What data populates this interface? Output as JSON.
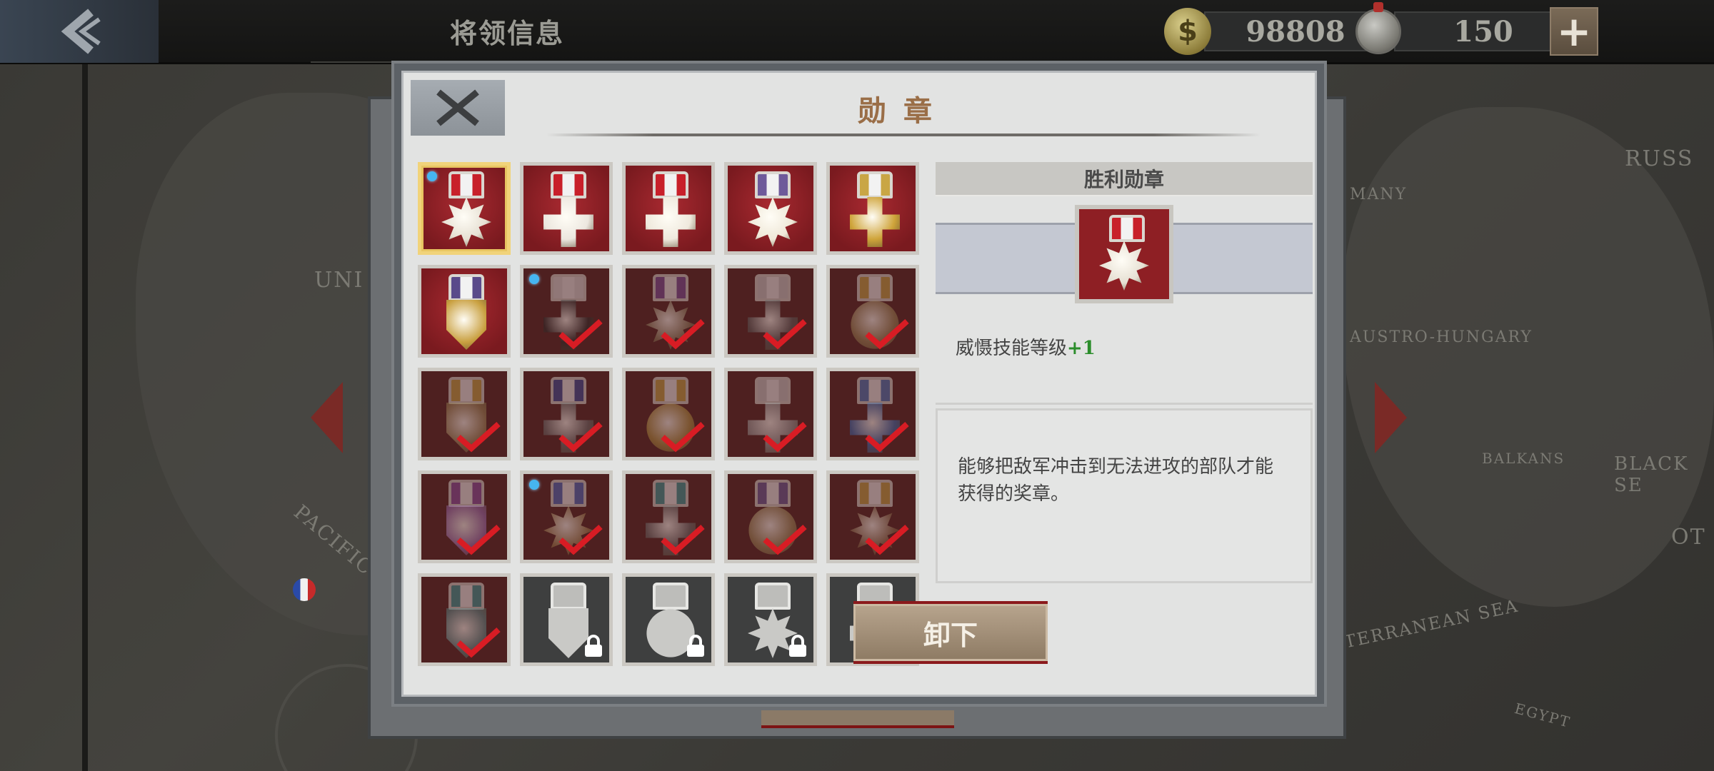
{
  "topbar": {
    "back_icon": "back-arrow-icon",
    "title": "将领信息",
    "gold_amount": "98808",
    "gold_symbol": "$",
    "medal_amount": "150",
    "plus_symbol": "+"
  },
  "map_labels": {
    "uni": "UNI",
    "russ": "RUSS",
    "many": "MANY",
    "austro": "AUSTRO-HUNGARY",
    "balkans": "BALKANS",
    "black_sea": "BLACK SE",
    "ot": "OT",
    "med": "TERRANEAN SEA",
    "egypt": "EGYPT",
    "pacific": "PACIFIC"
  },
  "modal": {
    "title": "勋章",
    "close_icon": "close-x-icon"
  },
  "medals": [
    {
      "state": "owned",
      "shape": "sun",
      "ribbon": "#c8202a",
      "metal": "#e6e0d3",
      "selected": true,
      "new": true
    },
    {
      "state": "owned",
      "shape": "cross",
      "ribbon": "#c8202a",
      "metal": "#ece7df",
      "selected": false,
      "new": false
    },
    {
      "state": "owned",
      "shape": "cross",
      "ribbon": "#c8202a",
      "metal": "#efe9dd",
      "selected": false,
      "new": false
    },
    {
      "state": "owned",
      "shape": "sun",
      "ribbon": "#6e5a9a",
      "metal": "#efe8d8",
      "selected": false,
      "new": false
    },
    {
      "state": "owned",
      "shape": "cross",
      "ribbon": "#c9a645",
      "metal": "#cfa43a",
      "selected": false,
      "new": false
    },
    {
      "state": "owned",
      "shape": "shield",
      "ribbon": "#5a4a8a",
      "metal": "#c9a040",
      "selected": false,
      "new": false
    },
    {
      "state": "done",
      "shape": "cross",
      "ribbon": "#e0e0e0",
      "metal": "#2a2a2a",
      "selected": false,
      "new": true
    },
    {
      "state": "done",
      "shape": "sun",
      "ribbon": "#7a4a9a",
      "metal": "#8b7a5a",
      "selected": false,
      "new": false
    },
    {
      "state": "done",
      "shape": "cross",
      "ribbon": "#d0d0d0",
      "metal": "#5a5a5a",
      "selected": false,
      "new": false
    },
    {
      "state": "done",
      "shape": "medal",
      "ribbon": "#c9a645",
      "metal": "#9c8455",
      "selected": false,
      "new": false
    },
    {
      "state": "done",
      "shape": "shield",
      "ribbon": "#c9a645",
      "metal": "#9c8455",
      "selected": false,
      "new": false
    },
    {
      "state": "done",
      "shape": "cross",
      "ribbon": "#3a4a9a",
      "metal": "#6a6a6a",
      "selected": false,
      "new": false
    },
    {
      "state": "done",
      "shape": "round",
      "ribbon": "#c9a645",
      "metal": "#b09040",
      "selected": false,
      "new": false
    },
    {
      "state": "done",
      "shape": "cross",
      "ribbon": "#d0d0d0",
      "metal": "#9a9a9a",
      "selected": false,
      "new": false
    },
    {
      "state": "done",
      "shape": "cross",
      "ribbon": "#4a7ac0",
      "metal": "#3a6ab0",
      "selected": false,
      "new": false
    },
    {
      "state": "done",
      "shape": "shield",
      "ribbon": "#8a4aa0",
      "metal": "#9a6ab0",
      "selected": false,
      "new": false
    },
    {
      "state": "done",
      "shape": "sun",
      "ribbon": "#4a6ac0",
      "metal": "#a08050",
      "selected": false,
      "new": true
    },
    {
      "state": "done",
      "shape": "cross",
      "ribbon": "#3a9a9a",
      "metal": "#6a6a6a",
      "selected": false,
      "new": false
    },
    {
      "state": "done",
      "shape": "medal",
      "ribbon": "#6a5a9a",
      "metal": "#a08a5a",
      "selected": false,
      "new": false
    },
    {
      "state": "done",
      "shape": "sun",
      "ribbon": "#c9a645",
      "metal": "#8a6a4a",
      "selected": false,
      "new": false
    },
    {
      "state": "done",
      "shape": "shield",
      "ribbon": "#3a9a9a",
      "metal": "#5a8a8a",
      "selected": false,
      "new": false
    },
    {
      "state": "locked",
      "shape": "shield",
      "ribbon": "#c0c0c0",
      "metal": "#c0c0c0",
      "selected": false,
      "new": false
    },
    {
      "state": "locked",
      "shape": "medal",
      "ribbon": "#c0c0c0",
      "metal": "#c0c0c0",
      "selected": false,
      "new": false
    },
    {
      "state": "locked",
      "shape": "sun",
      "ribbon": "#c0c0c0",
      "metal": "#c0c0c0",
      "selected": false,
      "new": false
    },
    {
      "state": "locked",
      "shape": "cross",
      "ribbon": "#c0c0c0",
      "metal": "#c0c0c0",
      "selected": false,
      "new": false
    }
  ],
  "detail": {
    "name": "胜利勋章",
    "effect_label": "威慑技能等级",
    "effect_bonus": "+1",
    "description": "能够把敌军冲击到无法进攻的部队才能获得的奖章。",
    "unequip_label": "卸下"
  },
  "colors": {
    "accent_title": "#9a6e47",
    "bonus_green": "#2b8d2b",
    "check_red": "#d81c24",
    "new_dot_blue": "#46b5f0"
  }
}
